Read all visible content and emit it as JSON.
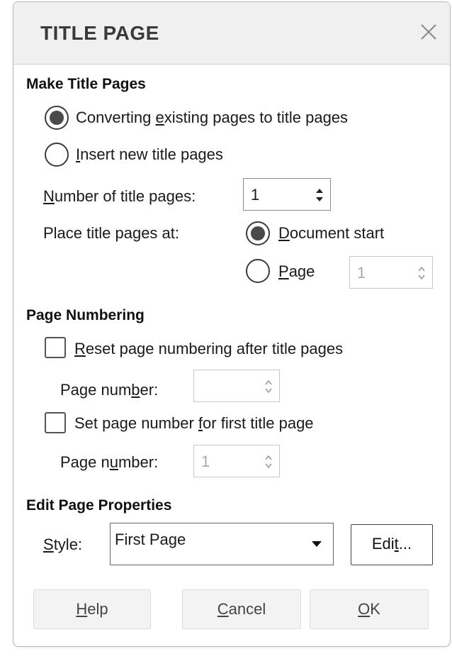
{
  "dialog": {
    "title": "TITLE PAGE"
  },
  "make": {
    "section_title": "Make Title Pages",
    "option_convert": {
      "pre": "Converting ",
      "key": "e",
      "post": "xisting pages to title pages",
      "checked": true
    },
    "option_insert": {
      "pre": "",
      "key": "I",
      "post": "nsert new title pages",
      "checked": false
    },
    "count_label": {
      "pre": "",
      "key": "N",
      "post": "umber of title pages:"
    },
    "count_value": "1",
    "place_label": "Place title pages at:",
    "place_doc": {
      "pre": "",
      "key": "D",
      "post": "ocument start",
      "checked": true
    },
    "place_page": {
      "pre": "",
      "key": "P",
      "post": "age",
      "checked": false
    },
    "place_page_value": "1"
  },
  "numbering": {
    "section_title": "Page Numbering",
    "reset": {
      "pre": "",
      "key": "R",
      "post": "eset page numbering after title pages",
      "checked": false
    },
    "reset_num_label": {
      "pre": "Page num",
      "key": "b",
      "post": "er:"
    },
    "reset_num_value": "",
    "setfirst": {
      "pre": "Set page number ",
      "key": "f",
      "post": "or first title page",
      "checked": false
    },
    "first_num_label": {
      "pre": "Page n",
      "key": "u",
      "post": "mber:"
    },
    "first_num_value": "1"
  },
  "edit": {
    "section_title": "Edit Page Properties",
    "style_label": {
      "pre": "",
      "key": "S",
      "post": "tyle:"
    },
    "style_value": "First Page",
    "edit_button": {
      "pre": "Edi",
      "key": "t",
      "post": "..."
    }
  },
  "footer": {
    "help": {
      "pre": "",
      "key": "H",
      "post": "elp"
    },
    "cancel": {
      "pre": "",
      "key": "C",
      "post": "ancel"
    },
    "ok": {
      "pre": "",
      "key": "O",
      "post": "K"
    }
  },
  "colors": {
    "titlebar_bg": "#f0f0f0",
    "radio_fill": "#4a4a4a",
    "button_bg": "#f3f3f3"
  }
}
